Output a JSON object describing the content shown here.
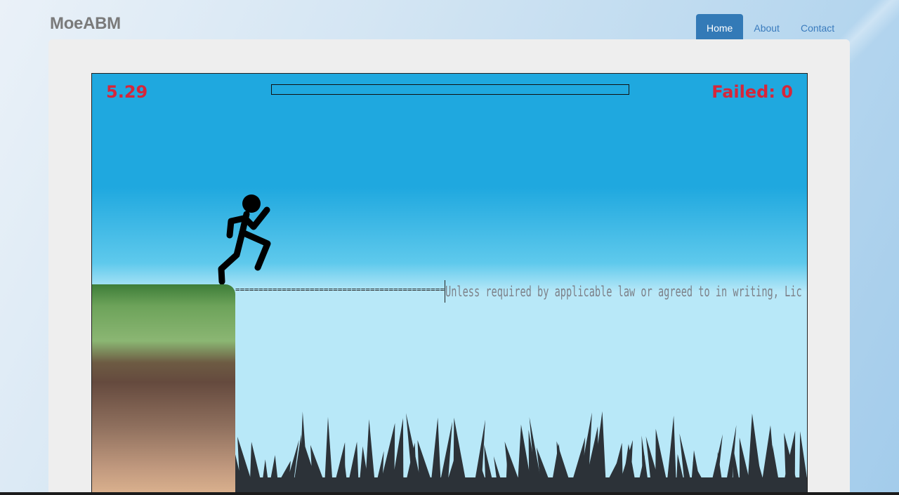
{
  "brand": {
    "name": "MoeABM"
  },
  "nav": {
    "items": [
      {
        "label": "Home",
        "active": true
      },
      {
        "label": "About",
        "active": false
      },
      {
        "label": "Contact",
        "active": false
      }
    ]
  },
  "game": {
    "timer": "5.29",
    "failed_label": "Failed: 0",
    "progress_fraction": 0,
    "rope_text": "=============================================",
    "typing_text": "Unless required by applicable law or agreed to in writing, Lic",
    "colors": {
      "hud_text": "#d6263a",
      "sky_top": "#1fa8df",
      "sky_bottom": "#b8e8f8",
      "grass_dark": "#2c3238"
    },
    "icons": [
      "stick-figure-runner",
      "grass-spikes"
    ]
  }
}
